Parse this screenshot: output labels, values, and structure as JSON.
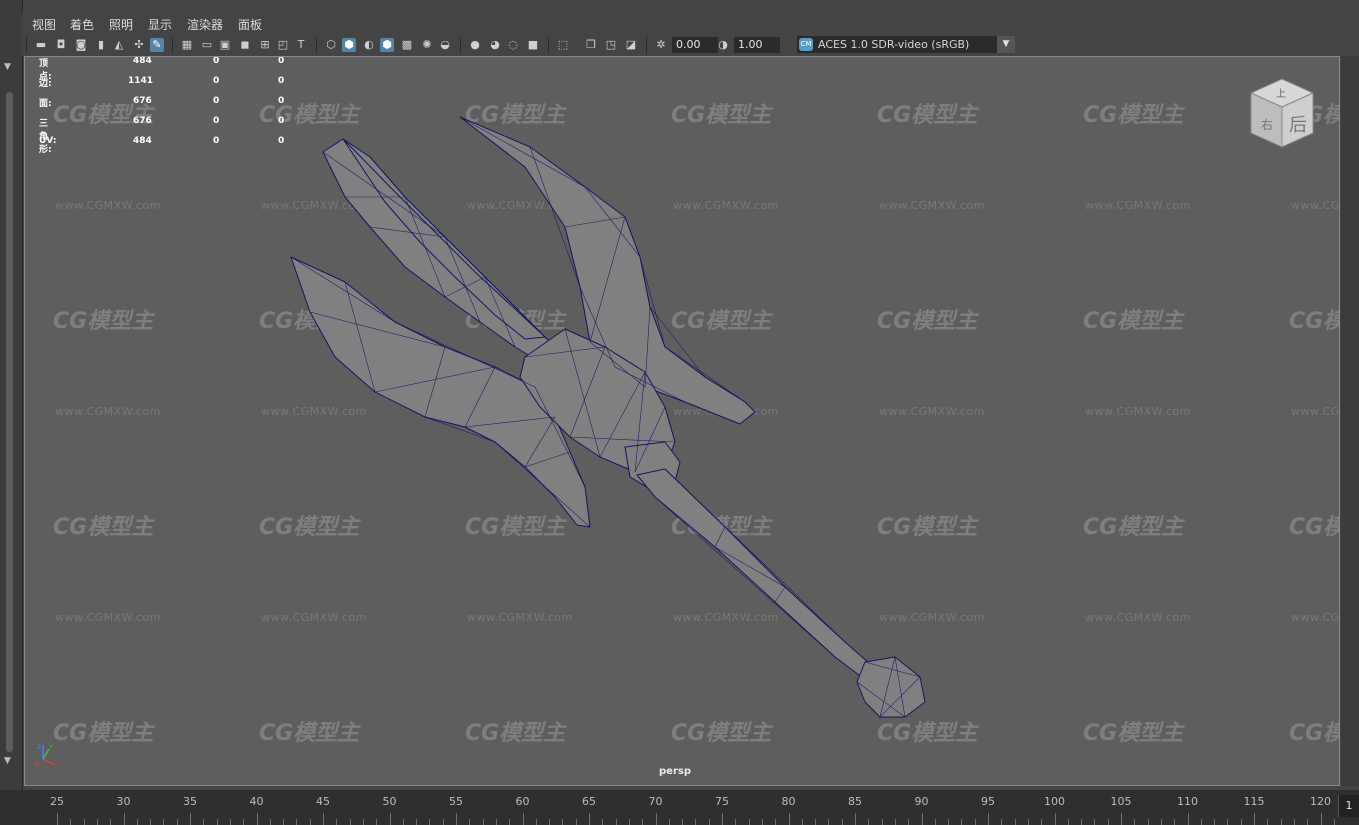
{
  "menu": [
    "视图",
    "着色",
    "照明",
    "显示",
    "渲染器",
    "面板"
  ],
  "toolbar": {
    "exposure_value": "0.00",
    "gamma_value": "1.00",
    "colorspace_badge": "CM",
    "colorspace_label": "ACES 1.0 SDR-video (sRGB)"
  },
  "hud": {
    "rows": [
      {
        "label": "顶点:",
        "total": "484",
        "sel": "0",
        "comp": "0"
      },
      {
        "label": "边:",
        "total": "1141",
        "sel": "0",
        "comp": "0"
      },
      {
        "label": "面:",
        "total": "676",
        "sel": "0",
        "comp": "0"
      },
      {
        "label": "三角形:",
        "total": "676",
        "sel": "0",
        "comp": "0"
      },
      {
        "label": "UV:",
        "total": "484",
        "sel": "0",
        "comp": "0"
      }
    ]
  },
  "viewcube": {
    "top": "上",
    "front": "后",
    "left": "右"
  },
  "camera_label": "persp",
  "watermark": {
    "logo": "CG模型主",
    "url": "www.CGMXW.com"
  },
  "axis": {
    "z": "Z",
    "x": "X",
    "y": "Y"
  },
  "timeline": {
    "ticks": [
      "25",
      "30",
      "35",
      "40",
      "45",
      "50",
      "55",
      "60",
      "65",
      "70",
      "75",
      "80",
      "85",
      "90",
      "95",
      "100",
      "105",
      "110",
      "115",
      "120"
    ],
    "current_frame": "1"
  },
  "colors": {
    "viewport_bg": "#5e5e5e",
    "mesh_fill": "#808080",
    "wireframe": "#1a1a6e",
    "accent": "#5285a6"
  }
}
